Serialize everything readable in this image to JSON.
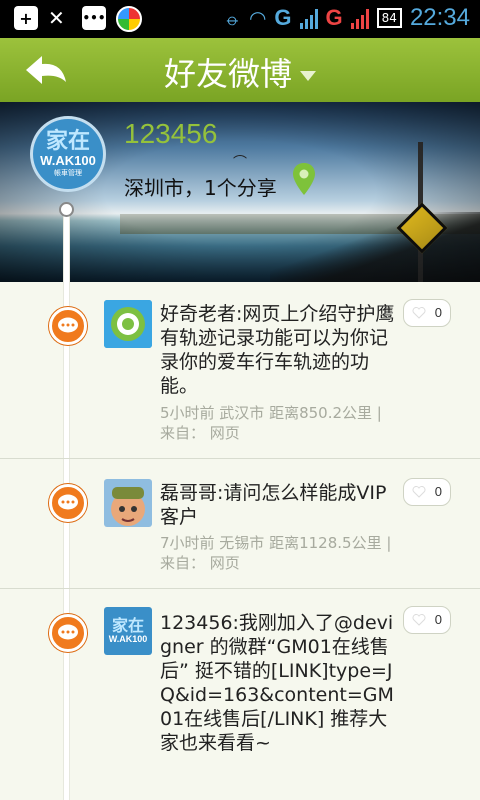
{
  "status_bar": {
    "network_1": "G",
    "network_2": "G",
    "battery": "84",
    "time": "22:34",
    "icons": [
      "add-icon",
      "call-icon",
      "message-icon",
      "browser-icon",
      "signal-icon",
      "wifi-icon"
    ]
  },
  "header": {
    "title": "好友微博",
    "back_icon": "back-arrow-icon",
    "dropdown_icon": "caret-down-icon"
  },
  "profile": {
    "name": "123456",
    "location_share": "深圳市，1个分享",
    "avatar_text": "家在",
    "avatar_sub": "W.AK100",
    "avatar_tag": "帳車管理"
  },
  "colors": {
    "accent": "#8fb832",
    "bubble": "#f07a1e",
    "meta": "#a7aa9e"
  },
  "posts": [
    {
      "text": "好奇老者:网页上介绍守护鹰有轨迹记录功能可以为你记录你的爱车行车轨迹的功能。",
      "meta": "5小时前 武汉市 距离850.2公里 | 来自： 网页",
      "likes": "0",
      "avatar": "green-logo-avatar"
    },
    {
      "text": "磊哥哥:请问怎么样能成VIP客户",
      "meta": "7小时前 无锡市 距离1128.5公里 | 来自： 网页",
      "likes": "0",
      "avatar": "cartoon-character-avatar"
    },
    {
      "text": "123456:我刚加入了@devigner 的微群“GM01在线售后” 挺不错的[LINK]type=JQ&id=163&content=GM01在线售后[/LINK] 推荐大家也来看看~",
      "likes": "0",
      "avatar": "brand-logo-avatar"
    }
  ]
}
